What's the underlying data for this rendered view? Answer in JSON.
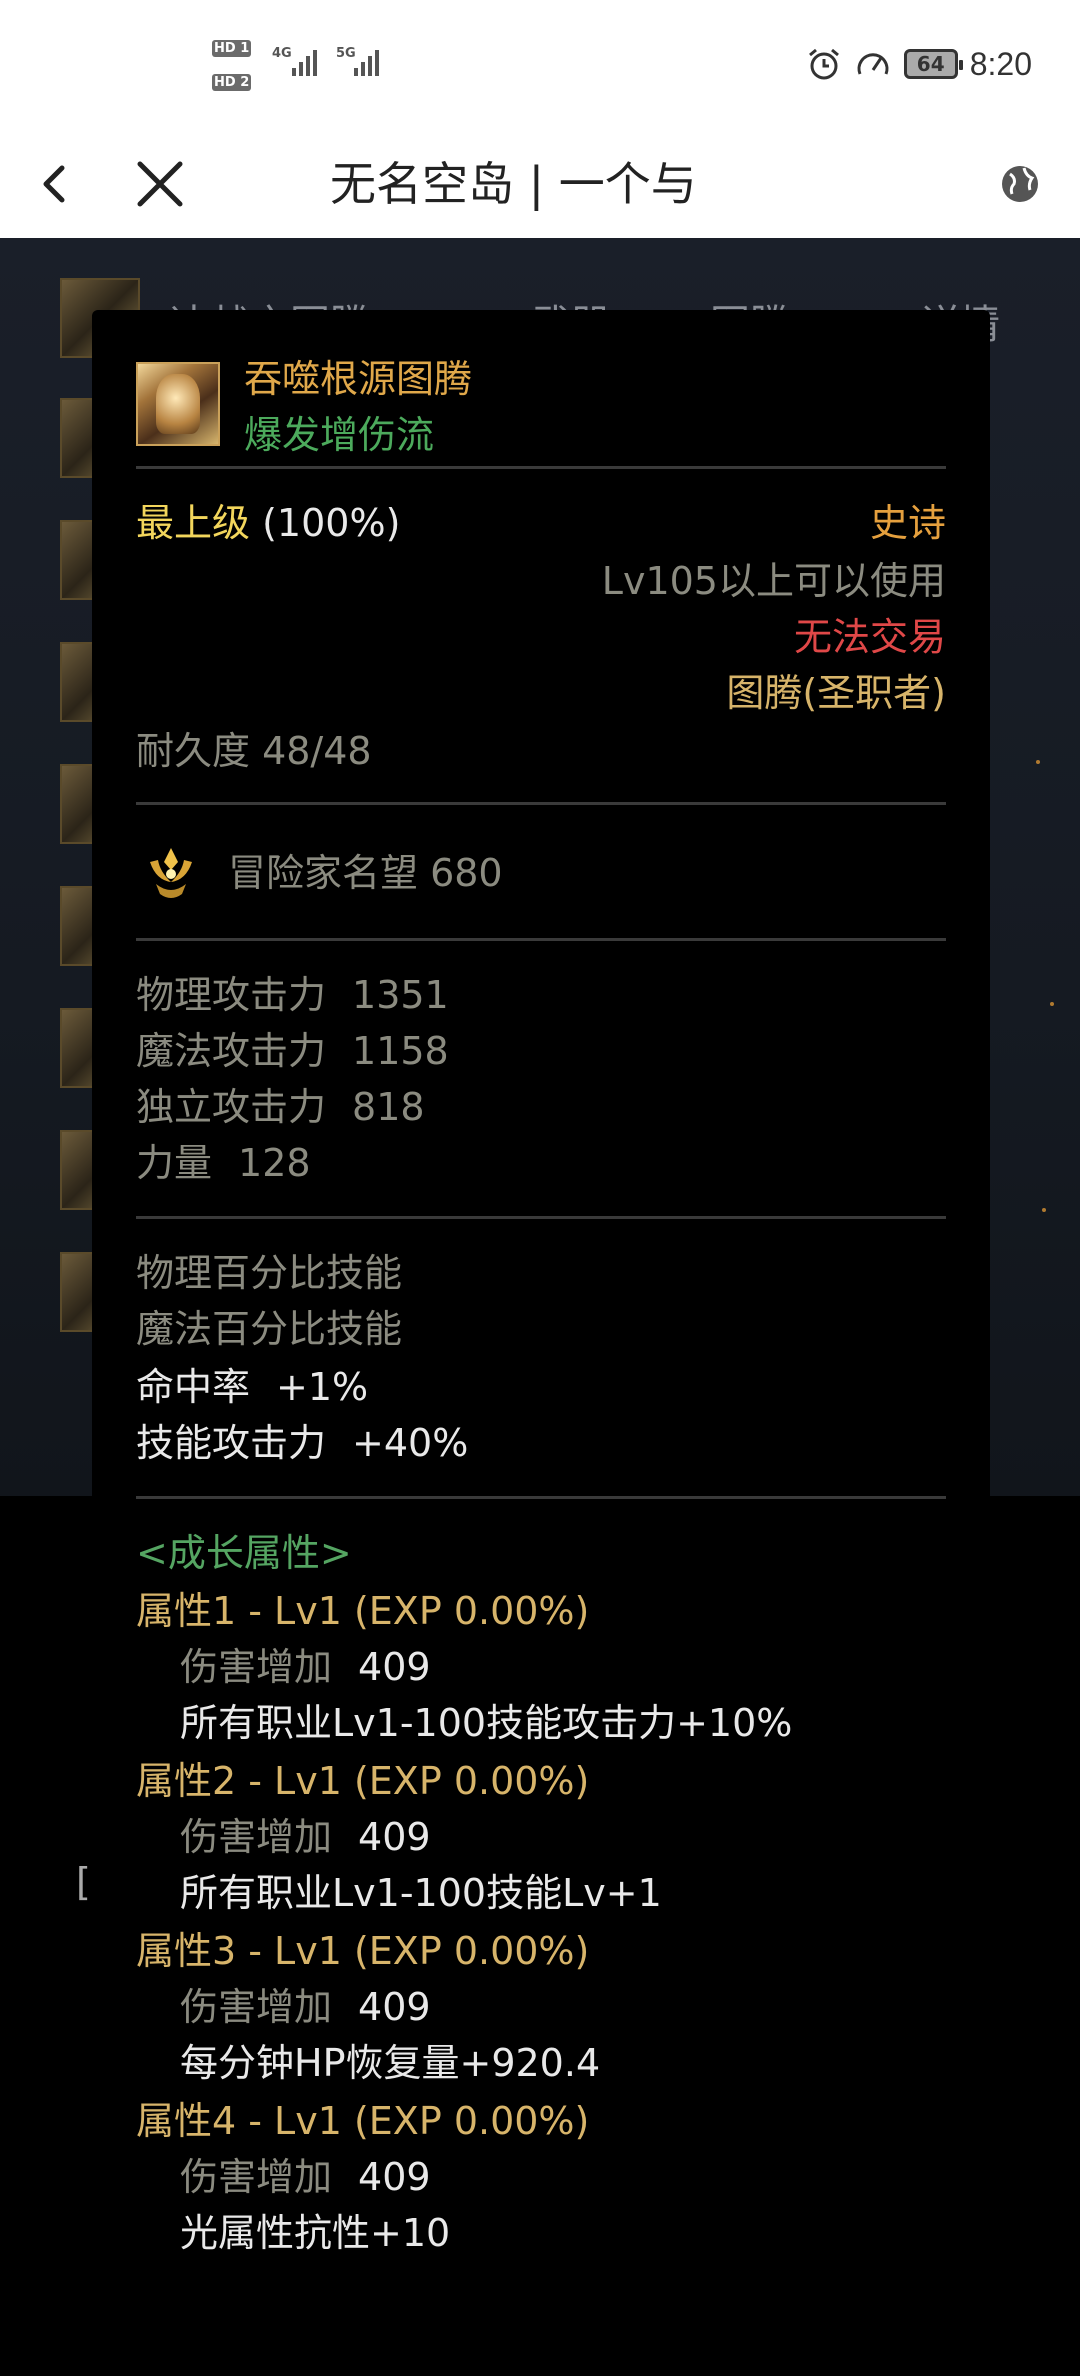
{
  "status_bar": {
    "sim1": "HD 1",
    "sim2": "HD 2",
    "net1": "4G",
    "net2": "5G",
    "battery": "64",
    "time": "8:20"
  },
  "navbar": {
    "title": "无名空岛 | 一个与"
  },
  "background": {
    "tabs": [
      "决战之图腾",
      "武器",
      "图腾",
      "详情"
    ]
  },
  "tooltip": {
    "item_name": "吞噬根源图腾",
    "item_subname": "爆发增伤流",
    "grade_label": "最上级",
    "grade_pct": "(100%)",
    "rarity": "史诗",
    "level_req": "Lv105以上可以使用",
    "trade": "无法交易",
    "type": "图腾(圣职者)",
    "durability": "耐久度 48/48",
    "fame": "冒险家名望 680",
    "stats": [
      {
        "label": "物理攻击力",
        "value": "1351"
      },
      {
        "label": "魔法攻击力",
        "value": "1158"
      },
      {
        "label": "独立攻击力",
        "value": "818"
      },
      {
        "label": "力量",
        "value": "128"
      }
    ],
    "skill_lines": [
      {
        "text": "物理百分比技能"
      },
      {
        "text": "魔法百分比技能"
      }
    ],
    "bonus_lines": [
      {
        "label": "命中率",
        "value": "+1%"
      },
      {
        "label": "技能攻击力",
        "value": "+40%"
      }
    ],
    "growth_title": "<成长属性>",
    "growth": [
      {
        "head": "属性1 - Lv1 (EXP 0.00%)",
        "dmg_label": "伤害增加",
        "dmg": "409",
        "effect": "所有职业Lv1-100技能攻击力+10%"
      },
      {
        "head": "属性2 - Lv1 (EXP 0.00%)",
        "dmg_label": "伤害增加",
        "dmg": "409",
        "effect": "所有职业Lv1-100技能Lv+1"
      },
      {
        "head": "属性3 - Lv1 (EXP 0.00%)",
        "dmg_label": "伤害增加",
        "dmg": "409",
        "effect": "每分钟HP恢复量+920.4"
      },
      {
        "head": "属性4 - Lv1 (EXP 0.00%)",
        "dmg_label": "伤害增加",
        "dmg": "409",
        "effect": "光属性抗性+10"
      }
    ]
  },
  "colors": {
    "item_name": "#e0a84a",
    "subname": "#4caa5c",
    "grade": "#f3d65c",
    "trade": "#e04848",
    "gray_text": "#8b8b80",
    "gold_text": "#d7b46a"
  }
}
